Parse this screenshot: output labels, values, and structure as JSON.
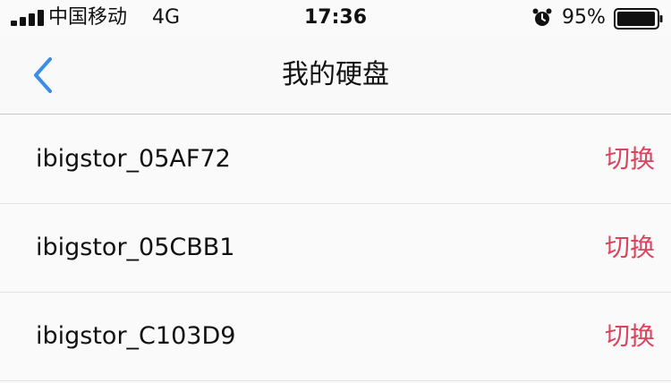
{
  "status_bar": {
    "carrier": "中国移动",
    "network": "4G",
    "time": "17:36",
    "battery_percent": "95%",
    "icons": [
      "signal-icon",
      "alarm-icon",
      "battery-icon"
    ]
  },
  "nav": {
    "title": "我的硬盘",
    "back_icon": "chevron-left-icon",
    "accent_color": "#3a8ee6"
  },
  "disks": {
    "items": [
      {
        "name": "ibigstor_05AF72",
        "action": "切换"
      },
      {
        "name": "ibigstor_05CBB1",
        "action": "切换"
      },
      {
        "name": "ibigstor_C103D9",
        "action": "切换"
      }
    ],
    "action_color": "#d9455f"
  }
}
